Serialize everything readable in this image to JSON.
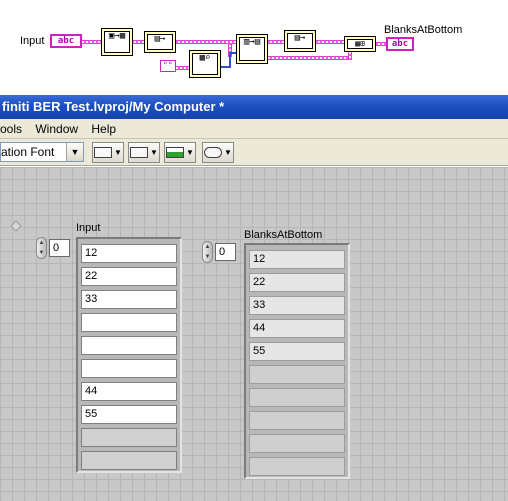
{
  "diagram": {
    "input_label": "Input",
    "output_label": "BlanksAtBottom",
    "input_terminal": "abc",
    "output_terminal": "abc",
    "string_constant": "\"\"",
    "colors": {
      "string_wire": "#ff55ee",
      "int_wire": "#3050c8"
    }
  },
  "window": {
    "title": "finiti BER Test.lvproj/My Computer *"
  },
  "menu": {
    "items": [
      "ools",
      "Window",
      "Help"
    ]
  },
  "toolbar": {
    "font_select": "ation Font",
    "buttons": [
      "align-objects",
      "distribute-objects",
      "resize-objects",
      "reorder"
    ]
  },
  "panel": {
    "input": {
      "label": "Input",
      "index": "0",
      "values": [
        "12",
        "22",
        "33",
        "",
        "",
        "",
        "44",
        "55",
        "",
        ""
      ],
      "element_count": 8
    },
    "output": {
      "label": "BlanksAtBottom",
      "index": "0",
      "values": [
        "12",
        "22",
        "33",
        "44",
        "55",
        "",
        "",
        "",
        "",
        ""
      ],
      "element_count": 5
    }
  }
}
